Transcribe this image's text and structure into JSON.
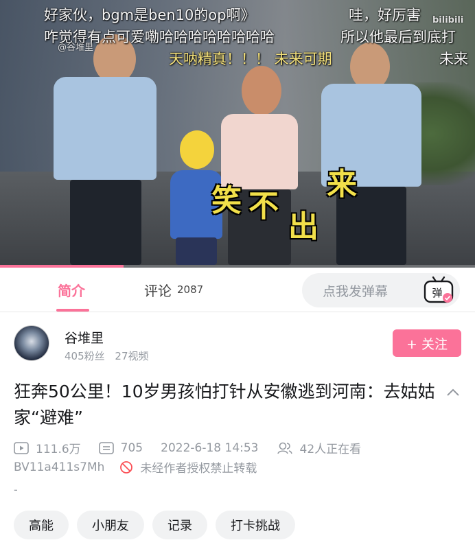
{
  "video": {
    "danmaku": [
      "好家伙，bgm是ben10的op啊》",
      "哇，好厉害",
      "咋觉得有点可爱嘞哈哈哈哈哈哈哈哈",
      "所以他最后到底打",
      "天呐精真！！！ 未来可期",
      "未来"
    ],
    "caption": [
      "笑",
      "不",
      "出",
      "来"
    ],
    "watermark": "@谷堆里",
    "brand": "bilibili",
    "progress": 0.26
  },
  "tabs": {
    "intro_label": "简介",
    "comments_label": "评论",
    "comments_count": "2087",
    "danmaku_placeholder": "点我发弹幕",
    "danmaku_icon_char": "弹"
  },
  "uploader": {
    "name": "谷堆里",
    "fans": "405粉丝",
    "videos": "27视频",
    "follow_label": "+ 关注"
  },
  "video_info": {
    "title": "狂奔50公里！10岁男孩怕打针从安徽逃到河南：去姑姑家“避难”",
    "plays": "111.6万",
    "danmaku_count": "705",
    "date": "2022-6-18 14:53",
    "watching": "42人正在看",
    "bvid": "BV11a411s7Mh",
    "copyright": "未经作者授权禁止转载",
    "description": "-"
  },
  "tags": [
    "高能",
    "小朋友",
    "记录",
    "打卡挑战"
  ],
  "colors": {
    "accent": "#fb7299",
    "muted": "#9499a0"
  }
}
